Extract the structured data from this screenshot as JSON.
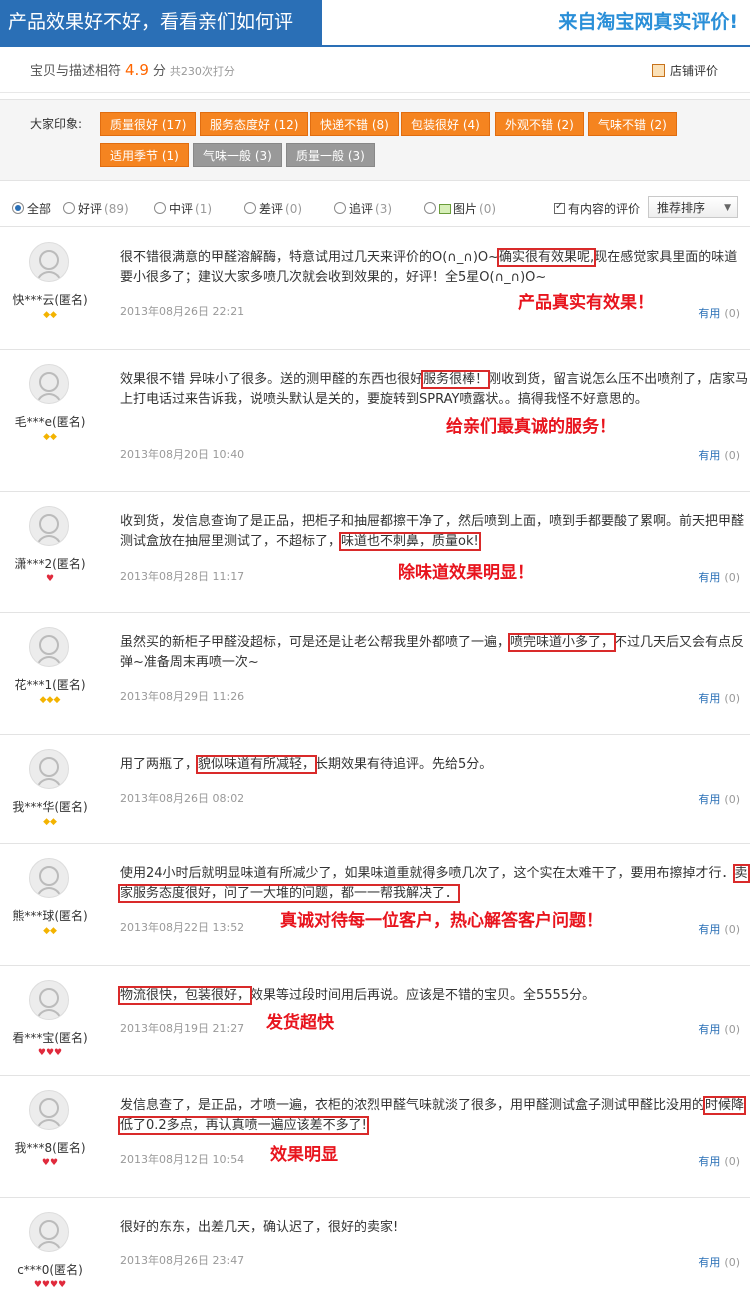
{
  "header": {
    "title": "产品效果好不好，看看亲们如何评价?",
    "subtitle": "来自淘宝网真实评价!"
  },
  "rating": {
    "label": "宝贝与描述相符",
    "score": "4.9",
    "unit": "分",
    "count": "共230次打分",
    "shop_label": "店铺评价"
  },
  "impressions": {
    "label": "大家印象:",
    "tags": [
      {
        "text": "质量很好 (17)",
        "positive": true
      },
      {
        "text": "服务态度好 (12)",
        "positive": true
      },
      {
        "text": "快递不错 (8)",
        "positive": true
      },
      {
        "text": "包装很好 (4)",
        "positive": true
      },
      {
        "text": "外观不错 (2)",
        "positive": true
      },
      {
        "text": "气味不错 (2)",
        "positive": true
      },
      {
        "text": "适用季节 (1)",
        "positive": true
      },
      {
        "text": "气味一般 (3)",
        "positive": false
      },
      {
        "text": "质量一般 (3)",
        "positive": false
      }
    ]
  },
  "filters": {
    "all": "全部",
    "good": "好评",
    "good_count": "(89)",
    "mid": "中评",
    "mid_count": "(1)",
    "bad": "差评",
    "bad_count": "(0)",
    "follow": "追评",
    "follow_count": "(3)",
    "pic": "图片",
    "pic_count": "(0)",
    "has_content": "有内容的评价",
    "sort": "推荐排序"
  },
  "reviews": [
    {
      "user": "快***云(匿名)",
      "level": "◆◆",
      "level_color": "gold",
      "text_a": "很不错很满意的甲醛溶解酶，特意试用过几天来评价的O(∩_∩)O~",
      "hl": "确实很有效果呢,",
      "text_b": "现在感觉家具里面的味道要小很多了；建议大家多喷几次就会收到效果的，好评！全5星O(∩_∩)O~",
      "date": "2013年08月26日 22:21",
      "note": "产品真实有效果！",
      "useful": "有用",
      "useful_count": "(0)"
    },
    {
      "user": "毛***e(匿名)",
      "level": "◆◆",
      "level_color": "gold",
      "text_a": "效果很不错 异味小了很多。送的测甲醛的东西也很好",
      "hl": "服务很棒！",
      "text_b": "刚收到货，留言说怎么压不出喷剂了，店家马上打电话过来告诉我，说喷头默认是关的，要旋转到SPRAY喷露状。。搞得我怪不好意思的。",
      "date": "2013年08月20日 10:40",
      "note": "给亲们最真诚的服务！",
      "useful": "有用",
      "useful_count": "(0)"
    },
    {
      "user": "潇***2(匿名)",
      "level": "♥",
      "level_color": "red",
      "text_a": "收到货，发信息查询了是正品，把柜子和抽屉都擦干净了，然后喷到上面，喷到手都要酸了累啊。前天把甲醛测试盒放在抽屉里测试了，不超标了，",
      "hl": "味道也不刺鼻，质量ok!",
      "text_b": "",
      "date": "2013年08月28日 11:17",
      "note": "除味道效果明显！",
      "useful": "有用",
      "useful_count": "(0)"
    },
    {
      "user": "花***1(匿名)",
      "level": "◆◆◆",
      "level_color": "gold",
      "text_a": "虽然买的新柜子甲醛没超标，可是还是让老公帮我里外都喷了一遍，",
      "hl": "喷完味道小多了，",
      "text_b": "不过几天后又会有点反弹~准备周末再喷一次~",
      "date": "2013年08月29日 11:26",
      "note": "",
      "useful": "有用",
      "useful_count": "(0)"
    },
    {
      "user": "我***华(匿名)",
      "level": "◆◆",
      "level_color": "gold",
      "text_a": "用了两瓶了，",
      "hl": "貌似味道有所减轻，",
      "text_b": "长期效果有待追评。先给5分。",
      "date": "2013年08月26日 08:02",
      "note": "",
      "useful": "有用",
      "useful_count": "(0)"
    },
    {
      "user": "熊***球(匿名)",
      "level": "◆◆",
      "level_color": "gold",
      "text_a": "使用24小时后就明显味道有所减少了，如果味道重就得多喷几次了，这个实在太难干了，要用布擦掉才行．",
      "hl": "卖家服务态度很好，问了一大堆的问题，都一一帮我解决了．",
      "text_b": "",
      "date": "2013年08月22日 13:52",
      "note": "真诚对待每一位客户，热心解答客户问题！",
      "useful": "有用",
      "useful_count": "(0)"
    },
    {
      "user": "看***宝(匿名)",
      "level": "♥♥♥",
      "level_color": "red",
      "text_a": "",
      "hl": "物流很快，包装很好，",
      "text_b": "效果等过段时间用后再说。应该是不错的宝贝。全5555分。",
      "date": "2013年08月19日 21:27",
      "note": "发货超快",
      "useful": "有用",
      "useful_count": "(0)"
    },
    {
      "user": "我***8(匿名)",
      "level": "♥♥",
      "level_color": "red",
      "text_a": "发信息查了，是正品，才喷一遍，衣柜的浓烈甲醛气味就淡了很多，用甲醛测试盒子测试甲醛比没用的",
      "hl": "时候降低了0.2多点，再认真喷一遍应该差不多了!",
      "text_b": "",
      "date": "2013年08月12日 10:54",
      "note": "效果明显",
      "useful": "有用",
      "useful_count": "(0)"
    },
    {
      "user": "c***0(匿名)",
      "level": "♥♥♥♥",
      "level_color": "red",
      "text_a": "很好的东东，出差几天，确认迟了，很好的卖家!",
      "hl": "",
      "text_b": "",
      "date": "2013年08月26日 23:47",
      "note": "",
      "useful": "有用",
      "useful_count": "(0)"
    }
  ]
}
